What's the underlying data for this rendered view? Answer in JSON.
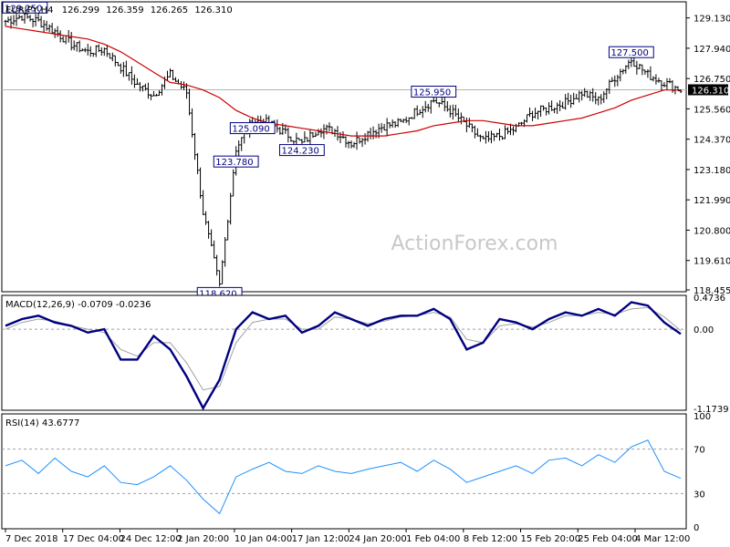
{
  "chart_data": [
    {
      "type": "candlestick",
      "title": "EURJPY,H4",
      "ohlc_readout": [
        "126.299",
        "126.359",
        "126.265",
        "126.310"
      ],
      "watermark": "ActionForex.com",
      "ylim": [
        118.455,
        129.69
      ],
      "yticks": [
        "129.130",
        "127.940",
        "126.750",
        "125.560",
        "124.370",
        "123.180",
        "121.990",
        "120.800",
        "119.610",
        "118.455"
      ],
      "last_price": 126.31,
      "last_price_label": "126.310",
      "moving_average": [
        128.8,
        128.7,
        128.6,
        128.5,
        128.4,
        128.3,
        128.1,
        127.8,
        127.4,
        127.0,
        126.6,
        126.5,
        126.3,
        126.0,
        125.5,
        125.2,
        125.0,
        124.9,
        124.8,
        124.7,
        124.6,
        124.5,
        124.5,
        124.5,
        124.6,
        124.7,
        124.9,
        125.0,
        125.1,
        125.1,
        125.0,
        124.9,
        124.9,
        125.0,
        125.1,
        125.2,
        125.4,
        125.6,
        125.9,
        126.1,
        126.3,
        126.3
      ],
      "price_path": [
        129.0,
        129.2,
        129.0,
        128.6,
        128.1,
        127.8,
        127.9,
        127.2,
        126.5,
        126.1,
        126.9,
        126.2,
        121.5,
        118.6,
        124.0,
        125.1,
        125.0,
        124.6,
        124.2,
        124.8,
        124.7,
        124.2,
        124.6,
        124.9,
        125.0,
        125.5,
        125.9,
        125.5,
        124.9,
        124.3,
        124.5,
        124.8,
        125.4,
        125.6,
        125.8,
        126.2,
        125.9,
        126.8,
        127.5,
        126.9,
        126.6,
        126.3
      ],
      "annotations": [
        {
          "label": "129.250",
          "value": 129.25
        },
        {
          "label": "125.090",
          "value": 125.09
        },
        {
          "label": "118.620",
          "value": 118.62
        },
        {
          "label": "123.780",
          "value": 123.78
        },
        {
          "label": "125.950",
          "value": 125.95
        },
        {
          "label": "124.230",
          "value": 124.23
        },
        {
          "label": "127.500",
          "value": 127.5
        }
      ]
    },
    {
      "type": "line",
      "title": "MACD(12,26,9) -0.0709 -0.0236",
      "ylim": [
        -1.1739,
        0.4736
      ],
      "yticks": [
        "0.4736",
        "0.00",
        "-1.1739"
      ],
      "macd": [
        0.05,
        0.15,
        0.2,
        0.1,
        0.05,
        -0.05,
        0.0,
        -0.45,
        -0.45,
        -0.1,
        -0.3,
        -0.7,
        -1.17,
        -0.75,
        0.0,
        0.25,
        0.15,
        0.2,
        -0.05,
        0.05,
        0.25,
        0.15,
        0.05,
        0.15,
        0.2,
        0.2,
        0.3,
        0.15,
        -0.3,
        -0.2,
        0.15,
        0.1,
        0.0,
        0.15,
        0.25,
        0.2,
        0.3,
        0.2,
        0.4,
        0.35,
        0.1,
        -0.07
      ],
      "signal": [
        0.0,
        0.1,
        0.15,
        0.12,
        0.05,
        0.0,
        -0.05,
        -0.3,
        -0.4,
        -0.2,
        -0.2,
        -0.5,
        -0.9,
        -0.85,
        -0.2,
        0.1,
        0.15,
        0.15,
        0.0,
        0.0,
        0.18,
        0.15,
        0.08,
        0.12,
        0.18,
        0.2,
        0.25,
        0.18,
        -0.15,
        -0.2,
        0.05,
        0.08,
        0.03,
        0.1,
        0.2,
        0.2,
        0.25,
        0.22,
        0.3,
        0.32,
        0.18,
        -0.02
      ]
    },
    {
      "type": "line",
      "title": "RSI(14) 43.6777",
      "ylim": [
        0,
        100
      ],
      "yticks": [
        "100",
        "70",
        "30",
        "0"
      ],
      "levels": [
        70,
        30
      ],
      "rsi": [
        55,
        60,
        48,
        62,
        50,
        45,
        55,
        40,
        38,
        45,
        55,
        42,
        25,
        12,
        45,
        52,
        58,
        50,
        48,
        55,
        50,
        48,
        52,
        55,
        58,
        50,
        60,
        52,
        40,
        45,
        50,
        55,
        48,
        60,
        62,
        55,
        65,
        58,
        72,
        78,
        50,
        43.68
      ]
    }
  ],
  "x_axis": {
    "labels": [
      "7 Dec 2018",
      "17 Dec 04:00",
      "24 Dec 12:00",
      "2 Jan 20:00",
      "10 Jan 04:00",
      "17 Jan 12:00",
      "24 Jan 20:00",
      "1 Feb 04:00",
      "8 Feb 12:00",
      "15 Feb 20:00",
      "25 Feb 04:00",
      "4 Mar 12:00"
    ]
  },
  "colors": {
    "moving_average": "#cc0000",
    "macd": "#000080",
    "signal": "#a0a0a0",
    "rsi": "#1e90ff",
    "price": "#000000"
  }
}
